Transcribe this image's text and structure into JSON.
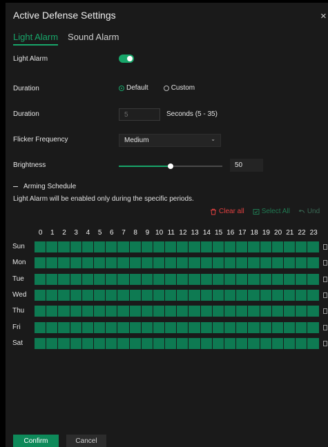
{
  "dialog": {
    "title": "Active Defense Settings",
    "close_icon": "×"
  },
  "tabs": [
    {
      "label": "Light Alarm",
      "active": true
    },
    {
      "label": "Sound Alarm",
      "active": false
    }
  ],
  "light_alarm": {
    "label": "Light Alarm",
    "enabled": true
  },
  "duration_mode": {
    "label": "Duration",
    "options": [
      {
        "label": "Default",
        "selected": true
      },
      {
        "label": "Custom",
        "selected": false
      }
    ]
  },
  "duration_value": {
    "label": "Duration",
    "value": "5",
    "suffix": "Seconds (5 - 35)"
  },
  "flicker": {
    "label": "Flicker Frequency",
    "selected": "Medium"
  },
  "brightness": {
    "label": "Brightness",
    "value": "50",
    "fraction": 0.5
  },
  "schedule": {
    "title": "Arming Schedule",
    "description": "Light Alarm will be enabled only during the specific periods.",
    "actions": {
      "clear_all": "Clear all",
      "select_all": "Select All",
      "undo": "Und"
    },
    "hours": [
      "0",
      "1",
      "2",
      "3",
      "4",
      "5",
      "6",
      "7",
      "8",
      "9",
      "10",
      "11",
      "12",
      "13",
      "14",
      "15",
      "16",
      "17",
      "18",
      "19",
      "20",
      "21",
      "22",
      "23"
    ],
    "days": [
      "Sun",
      "Mon",
      "Tue",
      "Wed",
      "Thu",
      "Fri",
      "Sat"
    ]
  },
  "footer": {
    "confirm": "Confirm",
    "cancel": "Cancel"
  },
  "colors": {
    "accent": "#18a66a",
    "schedule_cell": "#0e7a52",
    "danger": "#e14040",
    "background": "#1a1a1a"
  }
}
